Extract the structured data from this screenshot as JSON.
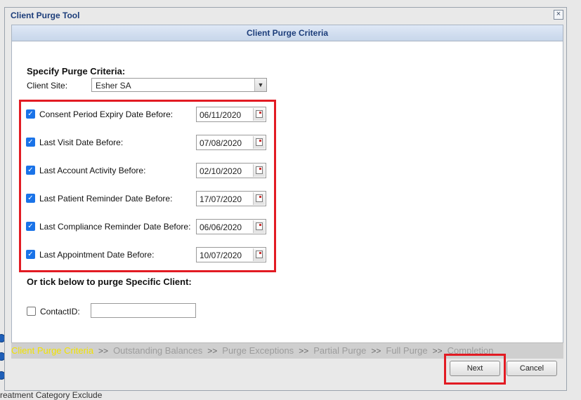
{
  "background": {
    "text": "reatment Category Exclude"
  },
  "dialog": {
    "title": "Client Purge Tool",
    "close_glyph": "×",
    "panel_header": "Client Purge Criteria",
    "specify_heading": "Specify Purge Criteria:",
    "client_site": {
      "label": "Client Site:",
      "value": "Esher SA",
      "dropdown_glyph": "▼"
    },
    "criteria": [
      {
        "label": "Consent Period Expiry Date Before:",
        "checked": true,
        "date": "06/11/2020"
      },
      {
        "label": "Last Visit Date Before:",
        "checked": true,
        "date": "07/08/2020"
      },
      {
        "label": "Last Account Activity Before:",
        "checked": true,
        "date": "02/10/2020"
      },
      {
        "label": "Last Patient Reminder Date Before:",
        "checked": true,
        "date": "17/07/2020"
      },
      {
        "label": "Last Compliance Reminder Date Before:",
        "checked": true,
        "date": "06/06/2020"
      },
      {
        "label": "Last Appointment Date Before:",
        "checked": true,
        "date": "10/07/2020"
      }
    ],
    "check_glyph": "✓",
    "specific_heading": "Or tick below to purge Specific Client:",
    "contact": {
      "label": "ContactID:",
      "checked": false,
      "value": ""
    },
    "steps": [
      {
        "label": "Client Purge Criteria",
        "active": true
      },
      {
        "label": "Outstanding Balances",
        "active": false
      },
      {
        "label": "Purge Exceptions",
        "active": false
      },
      {
        "label": "Partial Purge",
        "active": false
      },
      {
        "label": "Full Purge",
        "active": false
      },
      {
        "label": "Completion",
        "active": false
      }
    ],
    "step_separator": ">>",
    "buttons": {
      "next": "Next",
      "cancel": "Cancel"
    }
  },
  "colors": {
    "title_text": "#1c3d7a",
    "highlight_border": "#e21b23",
    "active_step": "#f2e200",
    "checkbox": "#1a73e8"
  }
}
